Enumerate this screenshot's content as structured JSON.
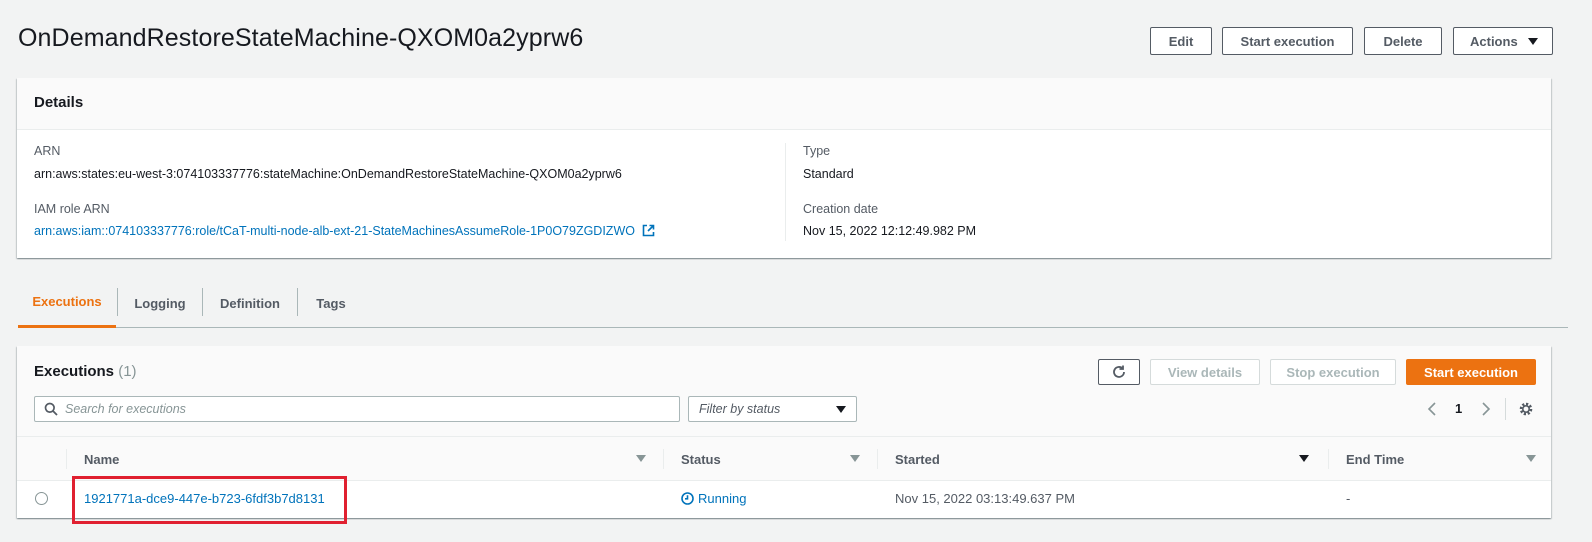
{
  "page": {
    "title": "OnDemandRestoreStateMachine-QXOM0a2yprw6",
    "actions": {
      "edit": "Edit",
      "start_execution": "Start execution",
      "delete": "Delete",
      "actions": "Actions"
    }
  },
  "details": {
    "heading": "Details",
    "arn_label": "ARN",
    "arn_value": "arn:aws:states:eu-west-3:074103337776:stateMachine:OnDemandRestoreStateMachine-QXOM0a2yprw6",
    "iam_label": "IAM role ARN",
    "iam_value": "arn:aws:iam::074103337776:role/tCaT-multi-node-alb-ext-21-StateMachinesAssumeRole-1P0O79ZGDIZWO",
    "type_label": "Type",
    "type_value": "Standard",
    "created_label": "Creation date",
    "created_value": "Nov 15, 2022 12:12:49.982 PM"
  },
  "tabs": [
    "Executions",
    "Logging",
    "Definition",
    "Tags"
  ],
  "executions": {
    "heading": "Executions",
    "count": "(1)",
    "view_details": "View details",
    "stop_execution": "Stop execution",
    "start_execution": "Start execution",
    "search_placeholder": "Search for executions",
    "filter_placeholder": "Filter by status",
    "page_number": "1",
    "columns": [
      "Name",
      "Status",
      "Started",
      "End Time"
    ],
    "rows": [
      {
        "name": "1921771a-dce9-447e-b723-6fdf3b7d8131",
        "status": "Running",
        "started": "Nov 15, 2022 03:13:49.637 PM",
        "end_time": "-"
      }
    ]
  },
  "colors": {
    "accent": "#ec7211",
    "link": "#0073bb",
    "highlight_box": "#e02030"
  }
}
